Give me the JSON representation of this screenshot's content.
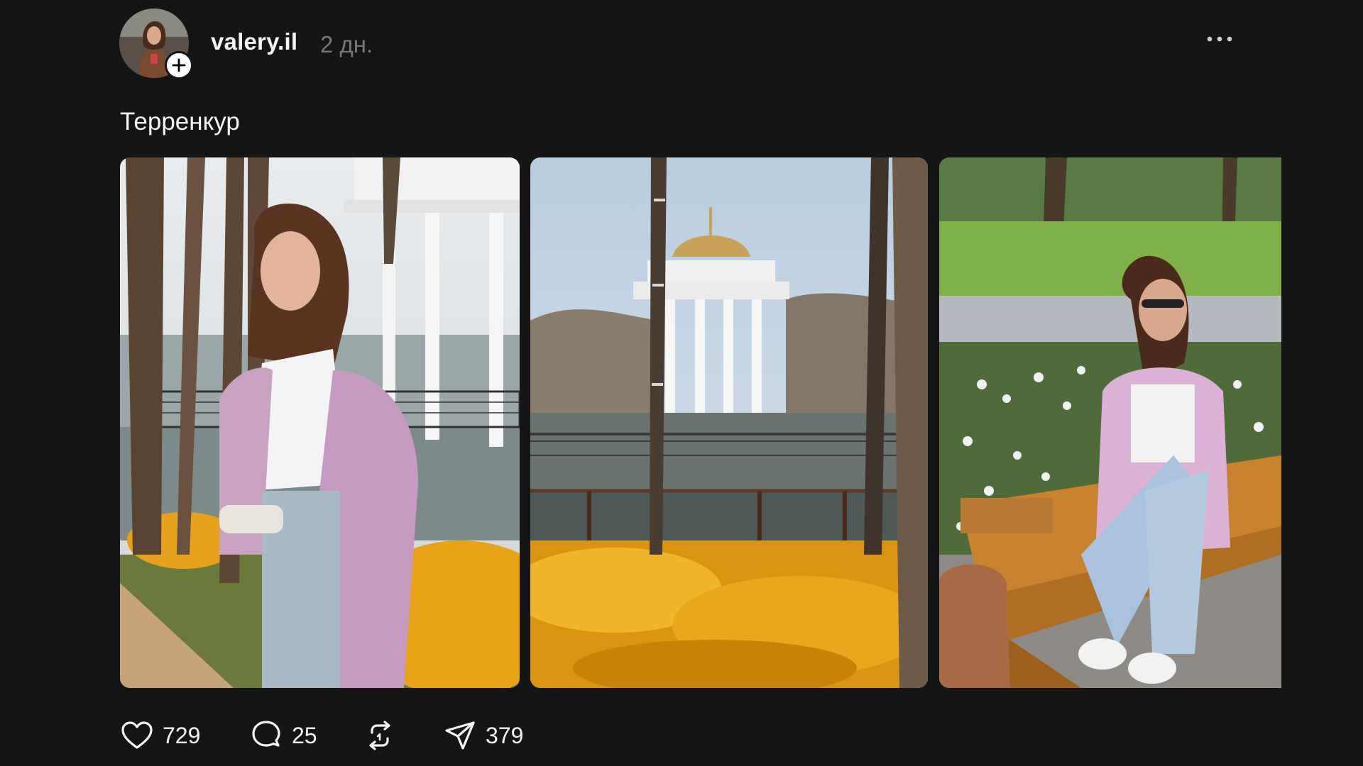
{
  "post": {
    "author": {
      "username": "valery.il",
      "avatar_icon": "avatar-photo",
      "follow_icon": "plus-icon"
    },
    "timestamp": "2 дн.",
    "more_icon": "more-horizontal-icon",
    "caption": "Терренкур",
    "media": [
      {
        "icon": "photo-woman-by-gazebo"
      },
      {
        "icon": "photo-gazebo-pond-flowers"
      },
      {
        "icon": "photo-woman-on-bench"
      }
    ],
    "actions": {
      "like": {
        "icon": "heart-icon",
        "count": "729"
      },
      "comment": {
        "icon": "comment-bubble-icon",
        "count": "25"
      },
      "repost": {
        "icon": "repost-icon",
        "count": ""
      },
      "share": {
        "icon": "send-icon",
        "count": "379"
      }
    }
  },
  "colors": {
    "background": "#151515",
    "text_primary": "#f3f5f7",
    "text_secondary": "#777777",
    "flowers": "#e8a317"
  }
}
